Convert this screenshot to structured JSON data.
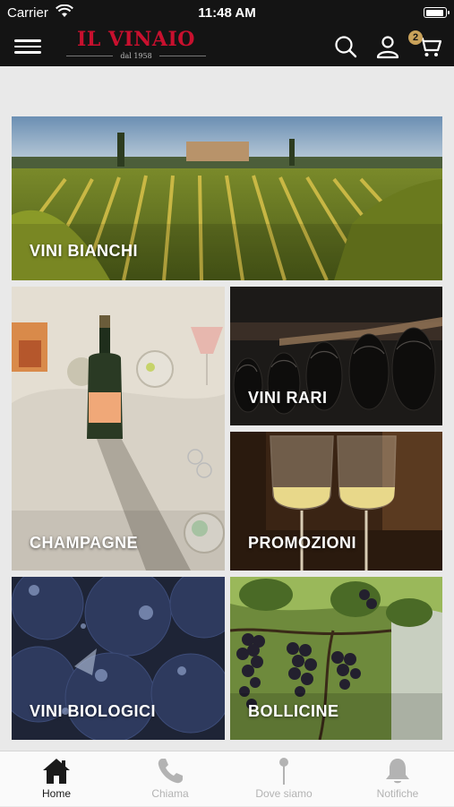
{
  "status_bar": {
    "carrier": "Carrier",
    "time": "11:48 AM"
  },
  "header": {
    "brand": "IL VINAIO",
    "tagline": "dal 1958",
    "cart_count": "2"
  },
  "tiles": {
    "vini_bianchi": "VINI BIANCHI",
    "champagne": "CHAMPAGNE",
    "vini_rari": "VINI RARI",
    "promozioni": "PROMOZIONI",
    "vini_biologici": "VINI BIOLOGICI",
    "bollicine": "BOLLICINE"
  },
  "tabbar": {
    "home": "Home",
    "chiama": "Chiama",
    "dove_siamo": "Dove siamo",
    "notifiche": "Notifiche"
  },
  "colors": {
    "header_bg": "#141414",
    "brand_red": "#c8102e",
    "badge_gold": "#c9a25a",
    "page_bg": "#e9e9e9"
  }
}
